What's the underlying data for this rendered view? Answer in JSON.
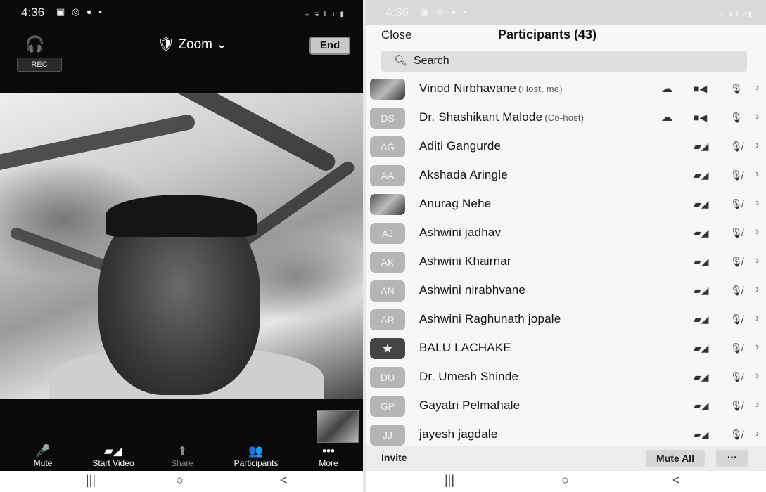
{
  "left": {
    "status": {
      "time": "4:36",
      "icons": "▣ ◎ ● •",
      "signal": "⏚ ᯤ ‖ .ıl ▮"
    },
    "header": {
      "title": "Zoom",
      "end_label": "End",
      "rec_label": "REC",
      "audio_icon": "headphones-icon"
    },
    "toolbar": [
      {
        "label": "Mute",
        "icon": "mic-icon",
        "glyph": "🎤",
        "name": "mute-button"
      },
      {
        "label": "Start Video",
        "icon": "video-off-icon",
        "glyph": "▰◢",
        "name": "start-video-button"
      },
      {
        "label": "Share",
        "icon": "share-icon",
        "glyph": "⬆",
        "name": "share-button"
      },
      {
        "label": "Participants",
        "icon": "participants-icon",
        "glyph": "👥",
        "name": "participants-button"
      },
      {
        "label": "More",
        "icon": "more-icon",
        "glyph": "•••",
        "name": "more-button"
      }
    ],
    "nav": {
      "recents": "|||",
      "home": "○",
      "back": "<"
    }
  },
  "right": {
    "status": {
      "time": "4:36",
      "icons": "▣ ◎ ● •",
      "signal": "⏚ ᯤ ‖ .ıl ▮"
    },
    "header": {
      "close_label": "Close",
      "title": "Participants (43)"
    },
    "search": {
      "placeholder": "Search"
    },
    "participants": [
      {
        "initials": "",
        "name": "Vinod Nirbhavane",
        "role": "(Host, me)",
        "avatar": "photo",
        "share": true,
        "video": "on",
        "mic": "on"
      },
      {
        "initials": "DS",
        "name": "Dr. Shashikant Malode",
        "role": "(Co-host)",
        "avatar": "initials",
        "share": true,
        "video": "on",
        "mic": "on"
      },
      {
        "initials": "AG",
        "name": "Aditi Gangurde",
        "role": "",
        "avatar": "initials",
        "share": false,
        "video": "off",
        "mic": "muted"
      },
      {
        "initials": "AA",
        "name": "Akshada Aringle",
        "role": "",
        "avatar": "initials",
        "share": false,
        "video": "off",
        "mic": "muted"
      },
      {
        "initials": "",
        "name": "Anurag Nehe",
        "role": "",
        "avatar": "photo",
        "share": false,
        "video": "off",
        "mic": "muted"
      },
      {
        "initials": "AJ",
        "name": "Ashwini jadhav",
        "role": "",
        "avatar": "initials",
        "share": false,
        "video": "off",
        "mic": "muted"
      },
      {
        "initials": "AK",
        "name": "Ashwini Khairnar",
        "role": "",
        "avatar": "initials",
        "share": false,
        "video": "off",
        "mic": "muted"
      },
      {
        "initials": "AN",
        "name": "Ashwini nirabhvane",
        "role": "",
        "avatar": "initials",
        "share": false,
        "video": "off",
        "mic": "muted"
      },
      {
        "initials": "AR",
        "name": "Ashwini Raghunath jopale",
        "role": "",
        "avatar": "initials",
        "share": false,
        "video": "off",
        "mic": "muted"
      },
      {
        "initials": "★",
        "name": "BALU LACHAKE",
        "role": "",
        "avatar": "star",
        "share": false,
        "video": "off",
        "mic": "muted"
      },
      {
        "initials": "DU",
        "name": "Dr. Umesh Shinde",
        "role": "",
        "avatar": "initials",
        "share": false,
        "video": "off",
        "mic": "muted"
      },
      {
        "initials": "GP",
        "name": "Gayatri Pelmahale",
        "role": "",
        "avatar": "initials",
        "share": false,
        "video": "off",
        "mic": "muted"
      },
      {
        "initials": "JJ",
        "name": "jayesh jagdale",
        "role": "",
        "avatar": "initials",
        "share": false,
        "video": "off",
        "mic": "muted"
      }
    ],
    "bottom": {
      "invite_label": "Invite",
      "mute_all_label": "Mute All",
      "more_label": "···"
    },
    "nav": {
      "recents": "|||",
      "home": "○",
      "back": "<"
    }
  }
}
